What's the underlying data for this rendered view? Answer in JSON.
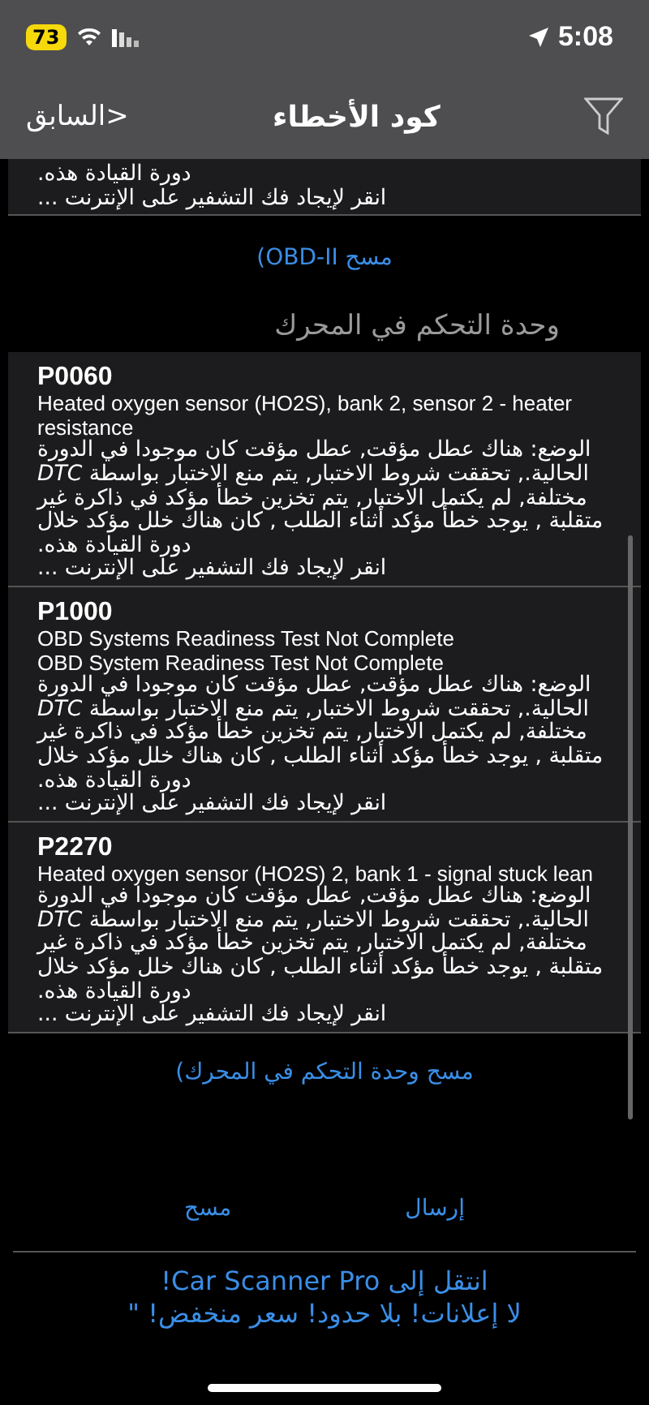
{
  "status_bar": {
    "battery": "73",
    "time": "5:08"
  },
  "nav": {
    "back": "<السابق",
    "title": "كود الأخطاء"
  },
  "previous_card": {
    "status": "دورة القيادة هذه.",
    "link": "انقر لإيجاد فك التشفير على الإنترنت ..."
  },
  "scan_obd": "مسح  OBD-II)",
  "section": {
    "title": "وحدة التحكم في المحرك",
    "codes": [
      {
        "code": "P0060",
        "descriptions": [
          "Heated oxygen sensor (HO2S), bank 2, sensor 2 - heater resistance"
        ],
        "status": "الوضع: هناك عطل مؤقت, عطل مؤقت كان موجودا في الدورة الحالية., تحققت شروط الاختبار, يتم منع الاختبار بواسطة *DTC* مختلفة, لم يكتمل الاختبار, يتم تخزين خطأ مؤكد في ذاكرة غير متقلبة , يوجد خطأ مؤكد أثناء الطلب , كان هناك خلل مؤكد خلال دورة القيادة هذه.",
        "link": "انقر لإيجاد فك التشفير على الإنترنت ..."
      },
      {
        "code": "P1000",
        "descriptions": [
          "OBD Systems Readiness Test Not Complete",
          "OBD System Readiness Test Not Complete"
        ],
        "status": "الوضع: هناك عطل مؤقت, عطل مؤقت كان موجودا في الدورة الحالية., تحققت شروط الاختبار, يتم منع الاختبار بواسطة *DTC* مختلفة, لم يكتمل الاختبار, يتم تخزين خطأ مؤكد في ذاكرة غير متقلبة , يوجد خطأ مؤكد أثناء الطلب , كان هناك خلل مؤكد خلال دورة القيادة هذه.",
        "link": "انقر لإيجاد فك التشفير على الإنترنت ..."
      },
      {
        "code": "P2270",
        "descriptions": [
          "Heated oxygen sensor (HO2S) 2, bank 1 - signal stuck lean"
        ],
        "status": "الوضع: هناك عطل مؤقت, عطل مؤقت كان موجودا في الدورة الحالية., تحققت شروط الاختبار, يتم منع الاختبار بواسطة *DTC* مختلفة, لم يكتمل الاختبار, يتم تخزين خطأ مؤكد في ذاكرة غير متقلبة , يوجد خطأ مؤكد أثناء الطلب , كان هناك خلل مؤكد خلال دورة القيادة هذه.",
        "link": "انقر لإيجاد فك التشفير على الإنترنت ..."
      }
    ],
    "scan": "مسح  وحدة التحكم في المحرك)"
  },
  "actions": [
    "إرسال",
    "مسح"
  ],
  "promo": {
    "line1": "انتقل إلى Car Scanner Pro!",
    "line2": "لا إعلانات! بلا حدود!  سعر منخفض! \""
  }
}
